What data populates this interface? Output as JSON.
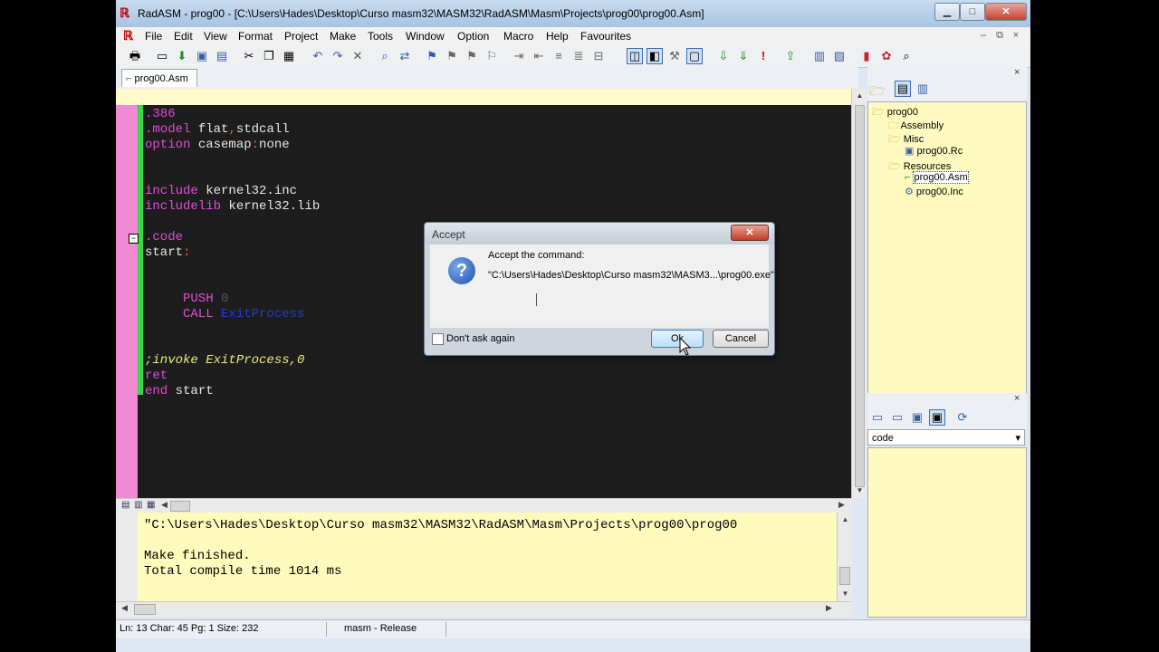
{
  "window": {
    "title": "RadASM - prog00 - [C:\\Users\\Hades\\Desktop\\Curso masm32\\MASM32\\RadASM\\Masm\\Projects\\prog00\\prog00.Asm]",
    "min_glyph": "▁",
    "max_glyph": "□",
    "close_glyph": "✕"
  },
  "menu": {
    "items": [
      "File",
      "Edit",
      "View",
      "Format",
      "Project",
      "Make",
      "Tools",
      "Window",
      "Option",
      "Macro",
      "Help",
      "Favourites"
    ],
    "mdi_min": "–",
    "mdi_restore": "⧉",
    "mdi_close": "×"
  },
  "toolbar": {
    "icons": [
      "print-icon",
      "new-file-icon",
      "open-file-icon",
      "save-icon",
      "save-all-icon",
      "cut-icon",
      "copy-icon",
      "paste-icon",
      "undo-icon",
      "redo-icon",
      "delete-icon",
      "find-icon",
      "replace-icon",
      "bookmark-icon",
      "next-bookmark-icon",
      "prev-bookmark-icon",
      "clear-bookmarks-icon",
      "indent-icon",
      "outdent-icon",
      "comment-icon",
      "uncomment-icon",
      "block-icon",
      "toggle-view-icon",
      "toggle-project-icon",
      "tools-icon",
      "output-icon",
      "assemble-icon",
      "build-icon",
      "run-icon",
      "debug-icon",
      "tile-icon",
      "cascade-icon",
      "colors-icon",
      "palette-icon",
      "zoom-icon"
    ]
  },
  "tab": {
    "label": "prog00.Asm",
    "close": "×"
  },
  "editor": {
    "lines": [
      {
        "segments": [
          {
            "text": ".386",
            "color": "#e24bd6"
          }
        ]
      },
      {
        "segments": [
          {
            "text": ".model",
            "color": "#e24bd6"
          },
          {
            "text": " flat",
            "color": "#e6e6e6"
          },
          {
            "text": ",",
            "color": "#ff5050"
          },
          {
            "text": "stdcall",
            "color": "#e6e6e6"
          }
        ]
      },
      {
        "segments": [
          {
            "text": "option",
            "color": "#e24bd6"
          },
          {
            "text": " casemap",
            "color": "#e6e6e6"
          },
          {
            "text": ":",
            "color": "#ff5050"
          },
          {
            "text": "none",
            "color": "#e6e6e6"
          }
        ]
      },
      {
        "segments": []
      },
      {
        "segments": []
      },
      {
        "segments": [
          {
            "text": "include",
            "color": "#e24bd6"
          },
          {
            "text": " kernel32.inc",
            "color": "#e6e6e6"
          }
        ]
      },
      {
        "segments": [
          {
            "text": "includelib",
            "color": "#e24bd6"
          },
          {
            "text": " kernel32.lib",
            "color": "#e6e6e6"
          }
        ]
      },
      {
        "segments": []
      },
      {
        "segments": [
          {
            "text": ".code",
            "color": "#e24bd6"
          }
        ]
      },
      {
        "segments": [
          {
            "text": "start",
            "color": "#e6e6e6"
          },
          {
            "text": ":",
            "color": "#ff5050"
          }
        ]
      },
      {
        "segments": []
      },
      {
        "segments": []
      },
      {
        "segments": [
          {
            "text": "     PUSH",
            "color": "#e24bd6"
          },
          {
            "text": " 0",
            "color": "#555555"
          }
        ]
      },
      {
        "segments": [
          {
            "text": "     CALL",
            "color": "#e24bd6"
          },
          {
            "text": " ExitProcess",
            "color": "#2a3ad0"
          }
        ]
      },
      {
        "segments": []
      },
      {
        "segments": []
      },
      {
        "segments": [
          {
            "text": ";invoke ExitProcess,0",
            "color": "#ecec7a",
            "italic": true
          }
        ]
      },
      {
        "segments": [
          {
            "text": "ret",
            "color": "#e24bd6"
          }
        ]
      },
      {
        "segments": [
          {
            "text": "end",
            "color": "#e24bd6"
          },
          {
            "text": " start",
            "color": "#e6e6e6"
          }
        ]
      }
    ],
    "fold_glyph": "−"
  },
  "output": {
    "lines": [
      "\"C:\\Users\\Hades\\Desktop\\Curso masm32\\MASM32\\RadASM\\Masm\\Projects\\prog00\\prog00",
      "",
      "Make finished.",
      "Total compile time 1014 ms"
    ]
  },
  "status": {
    "position": "Ln: 13 Char: 45 Pg: 1 Size: 232",
    "build": "masm - Release"
  },
  "project": {
    "tree": [
      {
        "label": "prog00",
        "icon": "folder-open-icon",
        "level": 0
      },
      {
        "label": "Assembly",
        "icon": "folder-icon",
        "level": 1
      },
      {
        "label": "Misc",
        "icon": "folder-open-icon",
        "level": 1
      },
      {
        "label": "prog00.Rc",
        "icon": "resource-file-icon",
        "level": 2
      },
      {
        "label": "Resources",
        "icon": "folder-open-icon",
        "level": 1
      },
      {
        "label": "prog00.Asm",
        "icon": "asm-file-icon",
        "level": 2,
        "selected": true
      },
      {
        "label": "prog00.Inc",
        "icon": "inc-file-icon",
        "level": 2
      }
    ]
  },
  "properties": {
    "selected": "code",
    "arrow": "▾"
  },
  "dialog": {
    "title": "Accept",
    "close": "✕",
    "prompt": "Accept the command:",
    "command": "\"C:\\Users\\Hades\\Desktop\\Curso masm32\\MASM3...\\prog00.exe\"",
    "dont_ask": "Don't ask again",
    "ok": "Ok",
    "cancel": "Cancel"
  },
  "colors": {
    "editor_bg": "#1d1d1d",
    "output_bg": "#fffbbd",
    "project_bg": "#fffbc0",
    "keyword": "#e24bd6"
  }
}
